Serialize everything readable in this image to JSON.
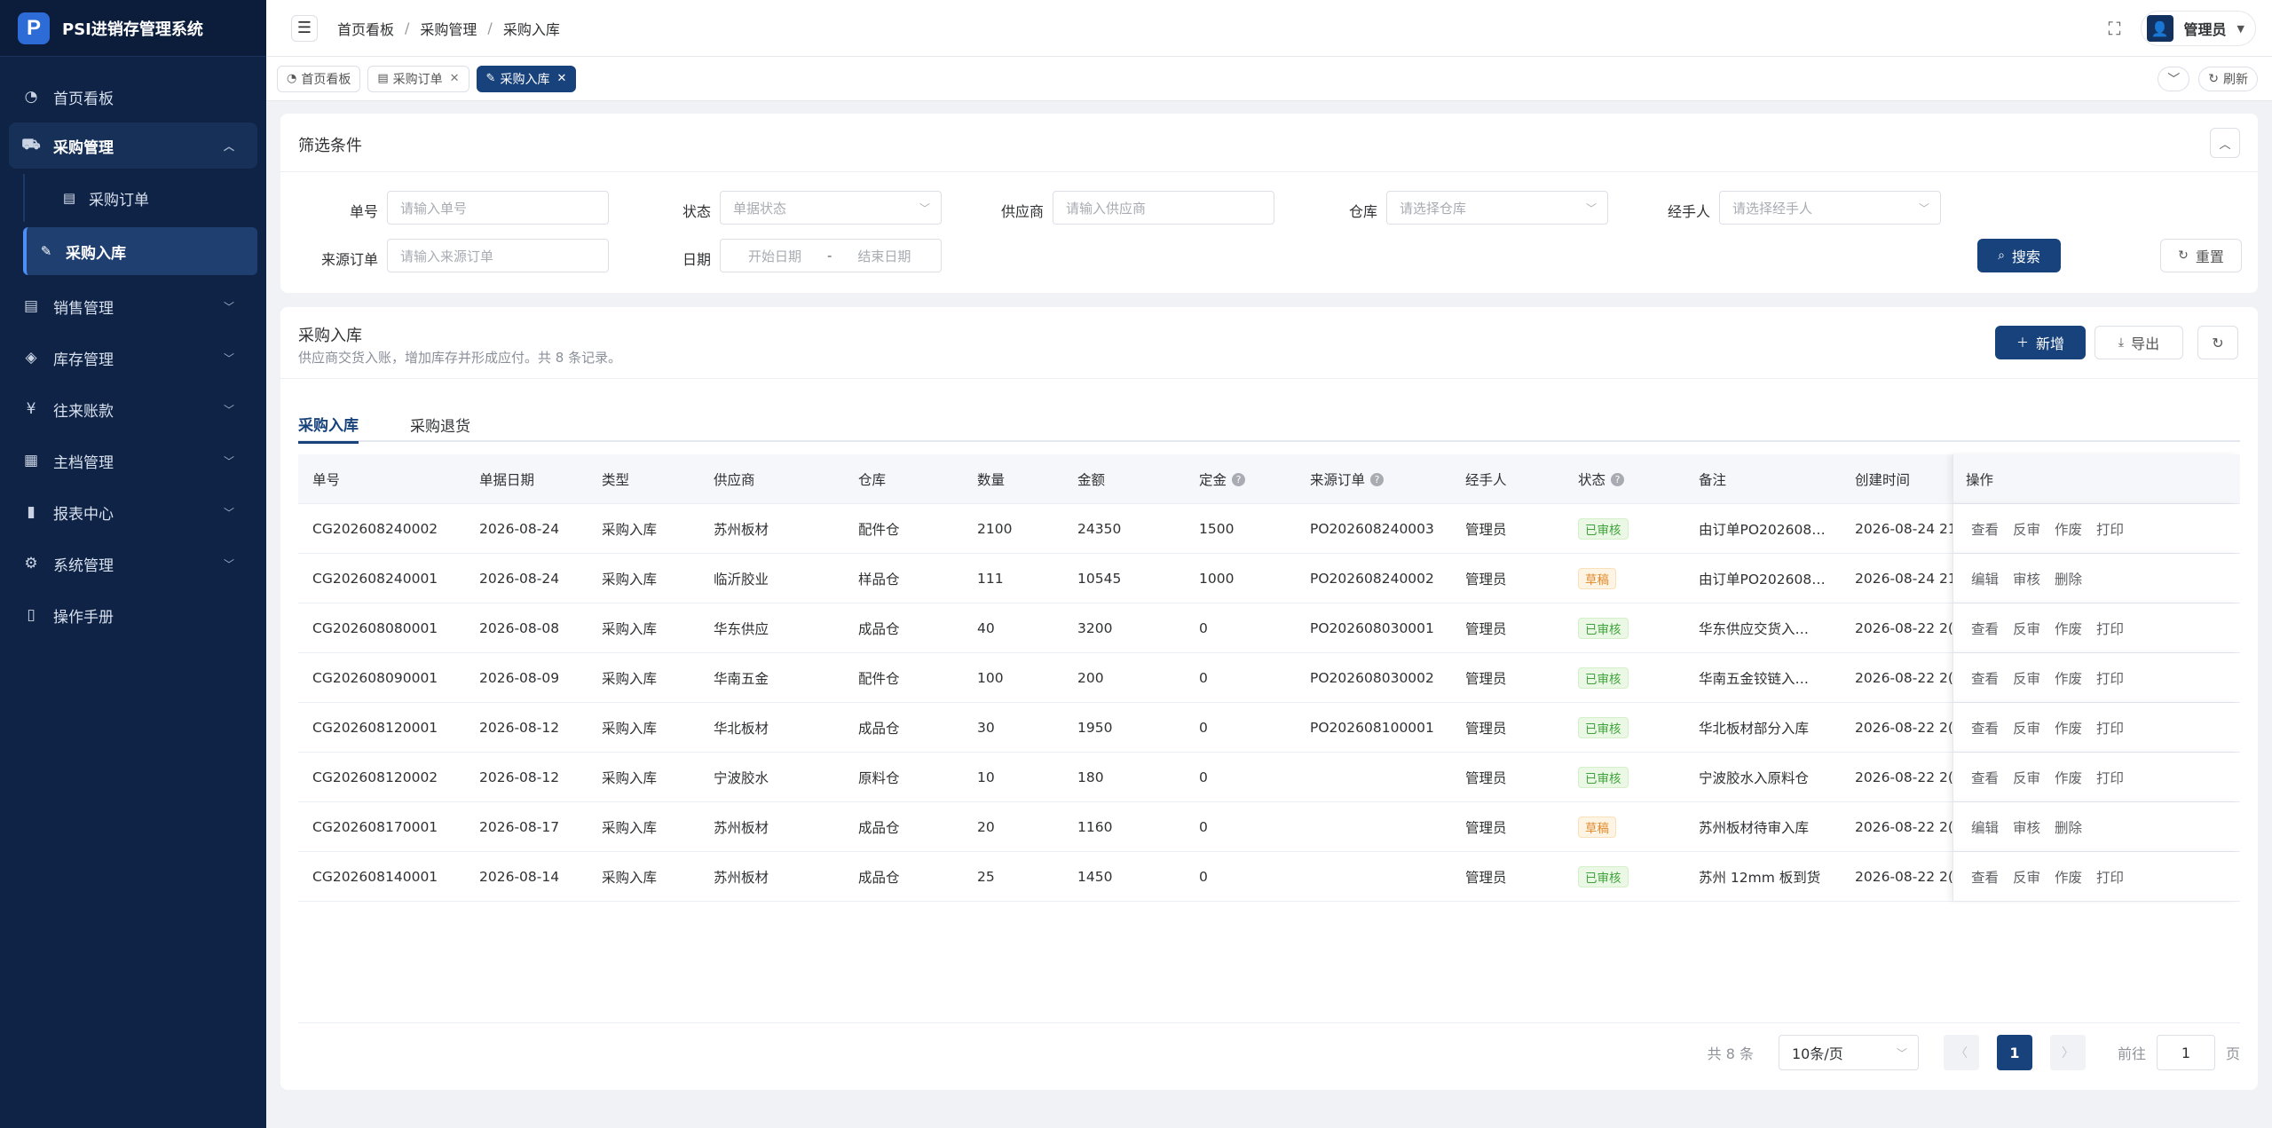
{
  "app": {
    "logo_letter": "P",
    "title": "PSI进销存管理系统"
  },
  "sidebar": {
    "items": [
      {
        "icon": "dashboard-icon",
        "glyph": "◔",
        "label": "首页看板"
      },
      {
        "icon": "cart-icon",
        "glyph": "🛒",
        "label": "采购管理",
        "open": true
      },
      {
        "icon": "sales-icon",
        "glyph": "▤",
        "label": "销售管理"
      },
      {
        "icon": "inventory-icon",
        "glyph": "◈",
        "label": "库存管理"
      },
      {
        "icon": "yen-icon",
        "glyph": "¥",
        "label": "往来账款"
      },
      {
        "icon": "master-data-icon",
        "glyph": "▦",
        "label": "主档管理"
      },
      {
        "icon": "report-icon",
        "glyph": "▮",
        "label": "报表中心"
      },
      {
        "icon": "gear-icon",
        "glyph": "⚙",
        "label": "系统管理"
      },
      {
        "icon": "manual-icon",
        "glyph": "▯",
        "label": "操作手册"
      }
    ],
    "sub_items": [
      {
        "icon": "order-icon",
        "glyph": "▤",
        "label": "采购订单"
      },
      {
        "icon": "edit-icon",
        "glyph": "✎",
        "label": "采购入库"
      }
    ]
  },
  "topbar": {
    "breadcrumb": [
      "首页看板",
      "采购管理",
      "采购入库"
    ],
    "user_name": "管理员"
  },
  "tags": {
    "items": [
      {
        "glyph": "◔",
        "label": "首页看板",
        "closable": false
      },
      {
        "glyph": "▤",
        "label": "采购订单",
        "closable": true
      },
      {
        "glyph": "✎",
        "label": "采购入库",
        "closable": true,
        "active": true
      }
    ],
    "refresh_label": "刷新"
  },
  "filter": {
    "title": "筛选条件",
    "order_no": {
      "label": "单号",
      "placeholder": "请输入单号"
    },
    "status": {
      "label": "状态",
      "placeholder": "单据状态"
    },
    "supplier": {
      "label": "供应商",
      "placeholder": "请输入供应商"
    },
    "warehouse": {
      "label": "仓库",
      "placeholder": "请选择仓库"
    },
    "handler": {
      "label": "经手人",
      "placeholder": "请选择经手人"
    },
    "source_order": {
      "label": "来源订单",
      "placeholder": "请输入来源订单"
    },
    "date": {
      "label": "日期",
      "start_placeholder": "开始日期",
      "separator": "-",
      "end_placeholder": "结束日期"
    },
    "search_label": "搜索",
    "reset_label": "重置"
  },
  "main": {
    "title": "采购入库",
    "subtitle": "供应商交货入账，增加库存并形成应付。共 8 条记录。",
    "add_label": "新增",
    "export_label": "导出",
    "tabs": [
      "采购入库",
      "采购退货"
    ],
    "columns": [
      "单号",
      "单据日期",
      "类型",
      "供应商",
      "仓库",
      "数量",
      "金额",
      "定金",
      "来源订单",
      "经手人",
      "状态",
      "备注",
      "创建时间",
      "操作"
    ],
    "rows": [
      {
        "no": "CG202608240002",
        "date": "2026-08-24",
        "type": "采购入库",
        "supplier": "苏州板材",
        "warehouse": "配件仓",
        "qty": "2100",
        "amount": "24350",
        "deposit": "1500",
        "source": "PO202608240003",
        "handler": "管理员",
        "status": "已审核",
        "status_kind": "ok",
        "remark": "由订单PO202608…",
        "created": "2026-08-24 21:",
        "ops": [
          "查看",
          "反审",
          "作废",
          "打印"
        ]
      },
      {
        "no": "CG202608240001",
        "date": "2026-08-24",
        "type": "采购入库",
        "supplier": "临沂胶业",
        "warehouse": "样品仓",
        "qty": "111",
        "amount": "10545",
        "deposit": "1000",
        "source": "PO202608240002",
        "handler": "管理员",
        "status": "草稿",
        "status_kind": "draft",
        "remark": "由订单PO202608…",
        "created": "2026-08-24 21:",
        "ops": [
          "编辑",
          "审核",
          "删除"
        ]
      },
      {
        "no": "CG202608080001",
        "date": "2026-08-08",
        "type": "采购入库",
        "supplier": "华东供应",
        "warehouse": "成品仓",
        "qty": "40",
        "amount": "3200",
        "deposit": "0",
        "source": "PO202608030001",
        "handler": "管理员",
        "status": "已审核",
        "status_kind": "ok",
        "remark": "华东供应交货入…",
        "created": "2026-08-22 2(",
        "ops": [
          "查看",
          "反审",
          "作废",
          "打印"
        ]
      },
      {
        "no": "CG202608090001",
        "date": "2026-08-09",
        "type": "采购入库",
        "supplier": "华南五金",
        "warehouse": "配件仓",
        "qty": "100",
        "amount": "200",
        "deposit": "0",
        "source": "PO202608030002",
        "handler": "管理员",
        "status": "已审核",
        "status_kind": "ok",
        "remark": "华南五金铰链入…",
        "created": "2026-08-22 2(",
        "ops": [
          "查看",
          "反审",
          "作废",
          "打印"
        ]
      },
      {
        "no": "CG202608120001",
        "date": "2026-08-12",
        "type": "采购入库",
        "supplier": "华北板材",
        "warehouse": "成品仓",
        "qty": "30",
        "amount": "1950",
        "deposit": "0",
        "source": "PO202608100001",
        "handler": "管理员",
        "status": "已审核",
        "status_kind": "ok",
        "remark": "华北板材部分入库",
        "created": "2026-08-22 2(",
        "ops": [
          "查看",
          "反审",
          "作废",
          "打印"
        ]
      },
      {
        "no": "CG202608120002",
        "date": "2026-08-12",
        "type": "采购入库",
        "supplier": "宁波胶水",
        "warehouse": "原料仓",
        "qty": "10",
        "amount": "180",
        "deposit": "0",
        "source": "",
        "handler": "管理员",
        "status": "已审核",
        "status_kind": "ok",
        "remark": "宁波胶水入原料仓",
        "created": "2026-08-22 2(",
        "ops": [
          "查看",
          "反审",
          "作废",
          "打印"
        ]
      },
      {
        "no": "CG202608170001",
        "date": "2026-08-17",
        "type": "采购入库",
        "supplier": "苏州板材",
        "warehouse": "成品仓",
        "qty": "20",
        "amount": "1160",
        "deposit": "0",
        "source": "",
        "handler": "管理员",
        "status": "草稿",
        "status_kind": "draft",
        "remark": "苏州板材待审入库",
        "created": "2026-08-22 2(",
        "ops": [
          "编辑",
          "审核",
          "删除"
        ]
      },
      {
        "no": "CG202608140001",
        "date": "2026-08-14",
        "type": "采购入库",
        "supplier": "苏州板材",
        "warehouse": "成品仓",
        "qty": "25",
        "amount": "1450",
        "deposit": "0",
        "source": "",
        "handler": "管理员",
        "status": "已审核",
        "status_kind": "ok",
        "remark": "苏州 12mm 板到货",
        "created": "2026-08-22 2(",
        "ops": [
          "查看",
          "反审",
          "作废",
          "打印"
        ]
      }
    ]
  },
  "pagination": {
    "total_text": "共 8 条",
    "page_size": "10条/页",
    "current_page": "1",
    "goto_label": "前往",
    "goto_value": "1",
    "page_suffix": "页"
  },
  "colors": {
    "sidebar_bg": "#0f2346",
    "primary": "#17427c",
    "ok": "#3fa33c",
    "draft": "#e0892a"
  }
}
